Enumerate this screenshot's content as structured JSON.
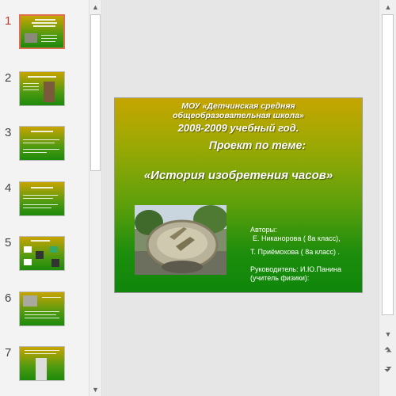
{
  "thumbnails": [
    {
      "num": "1",
      "selected": true
    },
    {
      "num": "2",
      "selected": false
    },
    {
      "num": "3",
      "selected": false
    },
    {
      "num": "4",
      "selected": false
    },
    {
      "num": "5",
      "selected": false
    },
    {
      "num": "6",
      "selected": false
    },
    {
      "num": "7",
      "selected": false
    }
  ],
  "slide": {
    "school_line1": "МОУ «Детчинская средняя",
    "school_line2": "общеобразовательная школа»",
    "year": "2008-2009 учебный год.",
    "project_label": "Проект по теме:",
    "title": "«История изобретения часов»",
    "authors_label": "Авторы:",
    "author1": "Е. Никанорова ( 8а класс),",
    "author2": "Т. Приёмохова ( 8а класс)  .",
    "supervisor": "Руководитель: И.Ю.Панина",
    "supervisor_role": "(учитель физики):"
  },
  "colors": {
    "slide_top": "#c6a500",
    "slide_bottom": "#0f860a",
    "selected_border": "#e07050",
    "selected_number": "#c0392b"
  },
  "icons": {
    "scroll_up": "triangle-up-icon",
    "scroll_down": "triangle-down-icon",
    "prev_slide": "double-chevron-up-icon",
    "next_slide": "double-chevron-down-icon"
  }
}
